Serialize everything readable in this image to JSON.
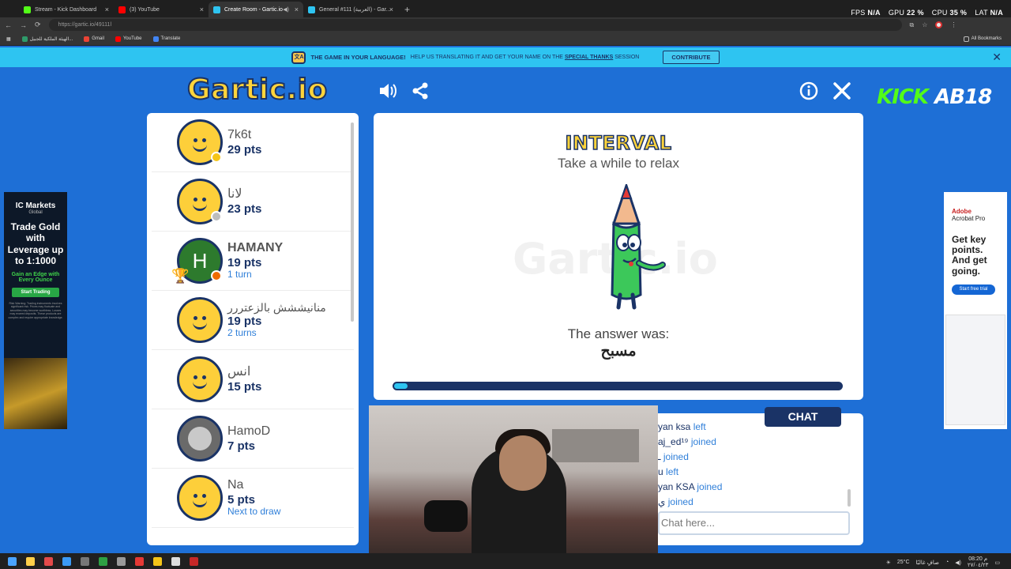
{
  "browser": {
    "tabs": [
      {
        "label": "Stream - Kick Dashboard",
        "color": "#53fc18"
      },
      {
        "label": "(3) YouTube",
        "color": "#ff0000"
      },
      {
        "label": "Create Room - Gartic.io",
        "color": "#2ec4f1"
      },
      {
        "label": "General #111 (العربية) - Gar...",
        "color": "#2ec4f1"
      }
    ],
    "url": "https://gartic.io/49111l",
    "bookmarks": [
      "الهيئة الملكية للجبيل...",
      "Gmail",
      "YouTube",
      "Translate"
    ],
    "all_bookmarks": "All Bookmarks",
    "perf": {
      "fps_label": "FPS",
      "fps": "N/A",
      "gpu_label": "GPU",
      "gpu": "22 %",
      "cpu_label": "CPU",
      "cpu": "35 %",
      "lat_label": "LAT",
      "lat": "N/A"
    }
  },
  "banner": {
    "headline": "THE GAME IN YOUR LANGUAGE!",
    "text": "HELP US TRANSLATING IT AND GET YOUR NAME ON THE",
    "link": "SPECIAL THANKS",
    "text_end": "SESSION",
    "button": "CONTRIBUTE"
  },
  "header": {
    "logo": "Gartic.io",
    "kick_green": "KICK",
    "kick_white": "AB18"
  },
  "players": [
    {
      "name": "7k6t",
      "points": "29 pts",
      "extra": "",
      "avatar": "smiley",
      "status_color": "#f5c518"
    },
    {
      "name": "لانا",
      "points": "23 pts",
      "extra": "",
      "avatar": "smiley",
      "status_color": "#bdbdbd"
    },
    {
      "name": "HAMANY",
      "points": "19 pts",
      "extra": "1 turn",
      "avatar": "letter",
      "letter": "H",
      "status_color": "#ef6c00",
      "trophy": true
    },
    {
      "name": "منانيششش بالزعتررر",
      "points": "19 pts",
      "extra": "2 turns",
      "avatar": "smiley"
    },
    {
      "name": "انس",
      "points": "15 pts",
      "extra": "",
      "avatar": "smiley"
    },
    {
      "name": "HamoD",
      "points": "7 pts",
      "extra": "",
      "avatar": "photo"
    },
    {
      "name": "Na",
      "points": "5 pts",
      "extra": "Next to draw",
      "avatar": "smiley"
    }
  ],
  "game": {
    "title": "INTERVAL",
    "subtitle": "Take a while to relax",
    "watermark": "Gartic.io",
    "answer_label": "The answer was:",
    "answer": "مسبح",
    "progress": 0.03
  },
  "chat": {
    "tab": "CHAT",
    "lines": [
      {
        "name": "yan ksa",
        "action": "left"
      },
      {
        "name": "aj_ed¹⁹",
        "action": "joined"
      },
      {
        "name": "ـ",
        "action": "joined"
      },
      {
        "name": "u",
        "action": "left"
      },
      {
        "name": "yan KSA",
        "action": "joined"
      },
      {
        "name": "ي",
        "action": "joined"
      }
    ],
    "placeholder": "Chat here..."
  },
  "ads": {
    "left": {
      "brand": "IC Markets",
      "brand_sub": "Global",
      "headline": "Trade Gold with Leverage up to 1:1000",
      "tagline": "Gain an Edge with Every Ounce",
      "button": "Start Trading",
      "fine": "Risk Warning: Trading instruments involves significant risk. Prices may fluctuate and securities may become worthless. Losses may exceed deposits. These products are complex and require appropriate knowledge."
    },
    "right": {
      "brand": "Adobe",
      "product": "Acrobat Pro",
      "headline": "Get key points. And get going.",
      "button": "Start free trial"
    }
  },
  "taskbar": {
    "weather": "25°C",
    "weather_label": "صافٍ غالبًا",
    "time": "08:20 م",
    "date": "٢٧/٠٤/٢٣"
  }
}
